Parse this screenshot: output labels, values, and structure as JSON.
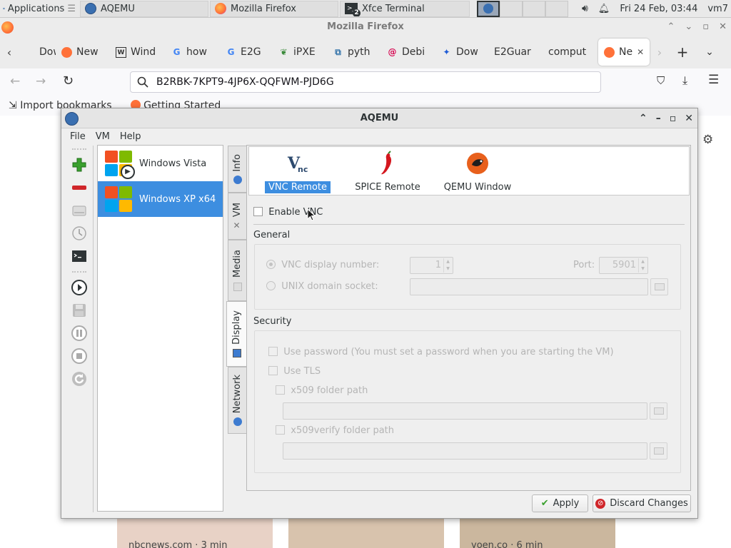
{
  "panel": {
    "applications": "Applications",
    "tasks": [
      "AQEMU",
      "Mozilla Firefox",
      "Xfce Terminal"
    ],
    "terminal_badge": "2",
    "datetime": "Fri 24 Feb, 03:44",
    "user": "vm7"
  },
  "firefox": {
    "title": "Mozilla Firefox",
    "tabs": [
      {
        "label": "Dow",
        "icon": "download-icon"
      },
      {
        "label": "New",
        "icon": "firefox-icon"
      },
      {
        "label": "Wind",
        "icon": "wikipedia-icon"
      },
      {
        "label": "how",
        "icon": "google-icon"
      },
      {
        "label": "E2G",
        "icon": "google-icon"
      },
      {
        "label": "iPXE",
        "icon": "ipxe-icon"
      },
      {
        "label": "pyth",
        "icon": "python-icon"
      },
      {
        "label": "Debi",
        "icon": "debian-icon"
      },
      {
        "label": "Dow",
        "icon": "bird-icon"
      },
      {
        "label": "E2Guar",
        "icon": "none"
      },
      {
        "label": "comput",
        "icon": "none"
      },
      {
        "label": "Ne",
        "icon": "firefox-icon"
      }
    ],
    "url": "B2RBK-7KPT9-4JP6X-QQFWM-PJD6G",
    "bookmarks": [
      "Import bookmarks",
      "Getting Started"
    ],
    "content_captions": [
      "nbcnews.com · 3 min",
      "",
      "yoen.co · 6 min"
    ]
  },
  "aqemu": {
    "title": "AQEMU",
    "menu": [
      "File",
      "VM",
      "Help"
    ],
    "vms": [
      {
        "name": "Windows Vista",
        "selected": false
      },
      {
        "name": "Windows XP x64",
        "selected": true
      }
    ],
    "side_tabs": [
      "Info",
      "VM",
      "Media",
      "Display",
      "Network"
    ],
    "active_tab": "Display",
    "viewers": [
      "VNC Remote",
      "SPICE Remote",
      "QEMU Window"
    ],
    "selected_viewer": "VNC Remote",
    "enable_vnc": {
      "label": "Enable VNC",
      "checked": false
    },
    "general": {
      "title": "General",
      "vnc_display_number_label": "VNC display number:",
      "vnc_display_number": "1",
      "port_label": "Port:",
      "port": "5901",
      "unix_socket_label": "UNIX domain socket:",
      "unix_socket_value": ""
    },
    "security": {
      "title": "Security",
      "use_password": "Use password (You must set a password when you are starting the VM)",
      "use_tls": "Use TLS",
      "x509_folder": "x509 folder path",
      "x509verify_folder": "x509verify folder path"
    },
    "buttons": {
      "apply": "Apply",
      "discard": "Discard Changes"
    }
  }
}
